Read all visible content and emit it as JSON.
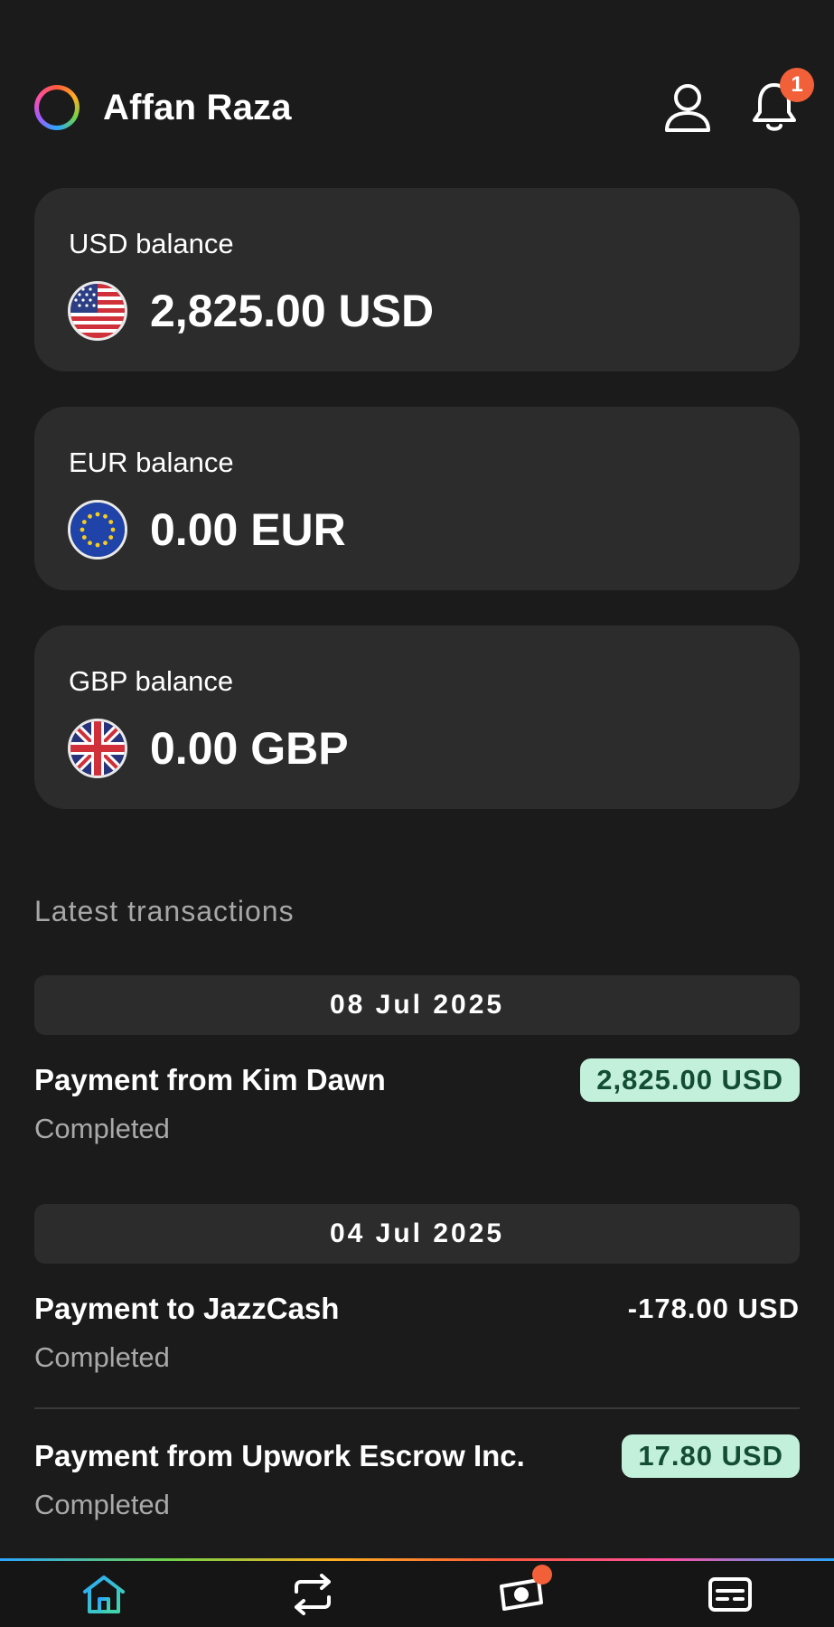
{
  "header": {
    "user_name": "Affan Raza",
    "notification_count": "1"
  },
  "balances": [
    {
      "label": "USD balance",
      "amount": "2,825.00 USD",
      "flag": "us-flag-icon"
    },
    {
      "label": "EUR balance",
      "amount": "0.00 EUR",
      "flag": "eu-flag-icon"
    },
    {
      "label": "GBP balance",
      "amount": "0.00 GBP",
      "flag": "uk-flag-icon"
    }
  ],
  "transactions_section": {
    "title": "Latest transactions",
    "groups": [
      {
        "date": "08 Jul 2025",
        "items": [
          {
            "title": "Payment from Kim Dawn",
            "status": "Completed",
            "amount": "2,825.00 USD",
            "type": "credit"
          }
        ]
      },
      {
        "date": "04 Jul 2025",
        "items": [
          {
            "title": "Payment to JazzCash",
            "status": "Completed",
            "amount": "-178.00 USD",
            "type": "debit"
          },
          {
            "title": "Payment from Upwork Escrow Inc.",
            "status": "Completed",
            "amount": "17.80 USD",
            "type": "credit"
          }
        ]
      }
    ]
  },
  "colors": {
    "credit_bg": "#c3f0db",
    "credit_text": "#134d33",
    "badge": "#f2603a",
    "card_bg": "#2c2c2c"
  },
  "bottom_nav": [
    "home-icon",
    "transfer-icon",
    "cash-icon",
    "card-icon"
  ]
}
